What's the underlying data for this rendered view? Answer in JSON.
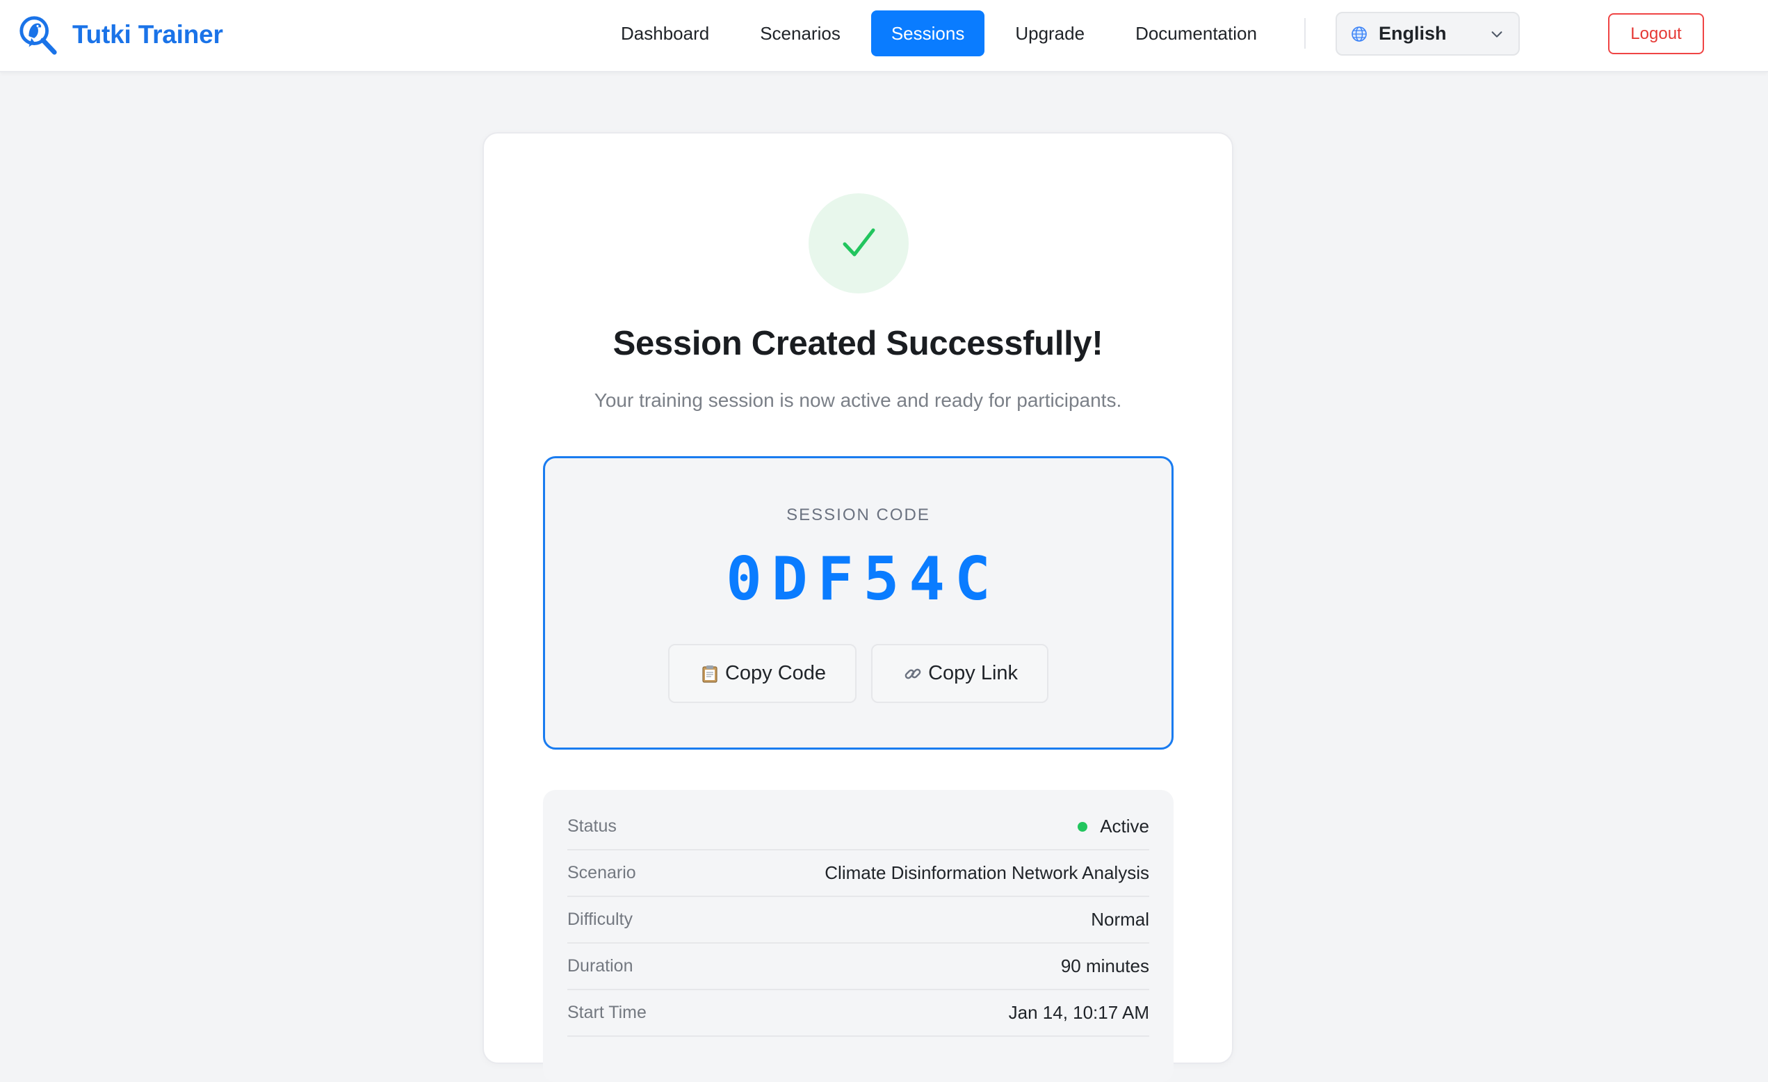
{
  "brand": {
    "name": "Tutki Trainer",
    "logo_icon": "magnifier-bird-icon",
    "color": "#1a73e8"
  },
  "nav": {
    "items": [
      {
        "label": "Dashboard",
        "active": false
      },
      {
        "label": "Scenarios",
        "active": false
      },
      {
        "label": "Sessions",
        "active": true
      },
      {
        "label": "Upgrade",
        "active": false
      },
      {
        "label": "Documentation",
        "active": false
      }
    ],
    "active_color": "#0a7cff"
  },
  "language": {
    "selected": "English",
    "icon": "globe-icon"
  },
  "logout": {
    "label": "Logout",
    "color": "#ef4444"
  },
  "success": {
    "icon": "checkmark-icon",
    "title": "Session Created Successfully!",
    "subtitle": "Your training session is now active and ready for participants."
  },
  "session_code": {
    "label": "SESSION CODE",
    "value": "0DF54C",
    "copy_code_label": "Copy Code",
    "copy_code_icon": "clipboard-icon",
    "copy_link_label": "Copy Link",
    "copy_link_icon": "link-icon"
  },
  "details": [
    {
      "label": "Status",
      "value": "Active",
      "status_color": "#22c55e"
    },
    {
      "label": "Scenario",
      "value": "Climate Disinformation Network Analysis"
    },
    {
      "label": "Difficulty",
      "value": "Normal"
    },
    {
      "label": "Duration",
      "value": "90 minutes"
    },
    {
      "label": "Start Time",
      "value": "Jan 14, 10:17 AM"
    }
  ]
}
